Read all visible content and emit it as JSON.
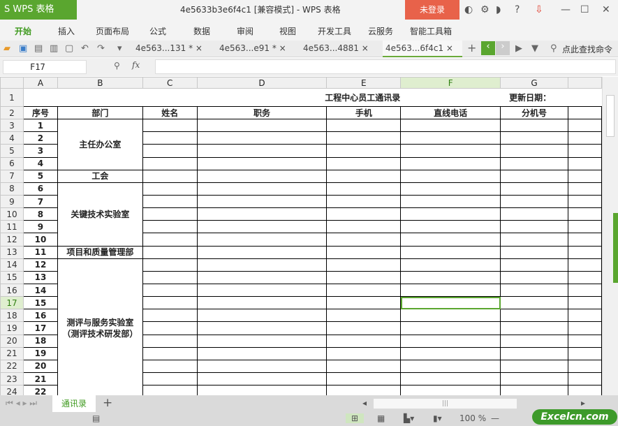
{
  "app": {
    "logo": "S WPS 表格",
    "title": "4e5633b3e6f4c1 [兼容模式] - WPS 表格",
    "login": "未登录"
  },
  "menu": [
    "开始",
    "插入",
    "页面布局",
    "公式",
    "数据",
    "审阅",
    "视图",
    "开发工具",
    "云服务",
    "智能工具箱"
  ],
  "doc_tabs": [
    "4e563...131 *",
    "4e563...e91 *",
    "4e563...4881",
    "4e563...6f4c1"
  ],
  "search": "点此查找命令",
  "name_box": "F17",
  "fx": "fx",
  "columns": [
    "A",
    "B",
    "C",
    "D",
    "E",
    "F",
    "G"
  ],
  "sheet": {
    "title": "工程中心员工通讯录",
    "update": "更新日期：",
    "headers": [
      "序号",
      "部门",
      "姓名",
      "职务",
      "手机",
      "直线电话",
      "分机号"
    ],
    "depts": [
      "主任办公室",
      "工会",
      "关键技术实验室",
      "项目和质量管理部",
      "测评与服务实验室（测评技术研发部）"
    ],
    "seq": [
      "1",
      "2",
      "3",
      "4",
      "5",
      "6",
      "7",
      "8",
      "9",
      "10",
      "11",
      "12",
      "13",
      "14",
      "15",
      "16",
      "17",
      "18",
      "19",
      "20",
      "21",
      "22"
    ]
  },
  "sheet_tabs": [
    "通讯录"
  ],
  "zoom": "100 %",
  "watermark": "Excelcn.com"
}
